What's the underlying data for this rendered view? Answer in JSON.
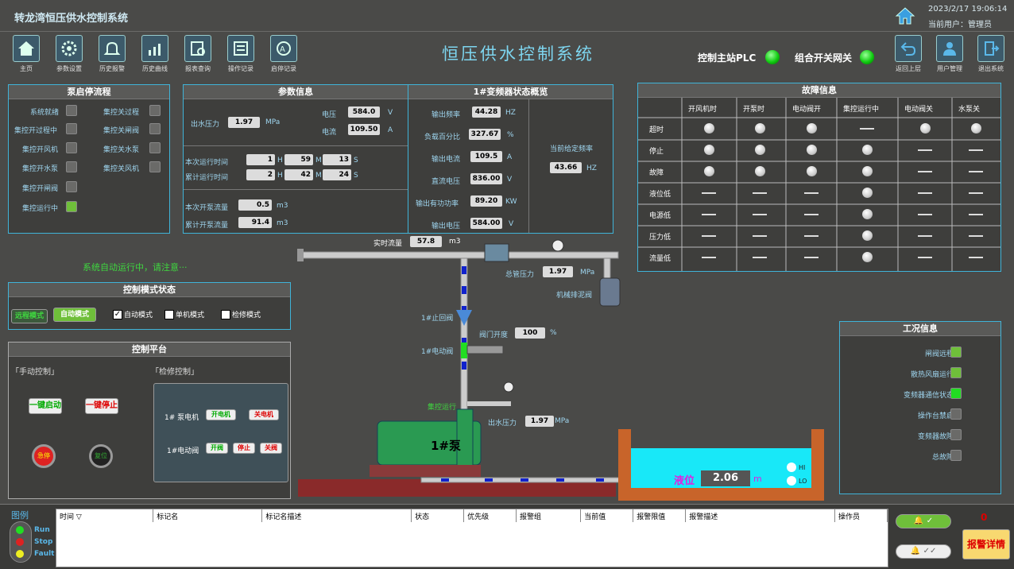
{
  "app": {
    "title": "转龙湾恒压供水控制系统",
    "datetime": "2023/2/17  19:06:14",
    "user": "当前用户：管理员",
    "main_title": "恒压供水控制系统"
  },
  "nav": [
    {
      "label": "主页",
      "icon": "home-icon"
    },
    {
      "label": "参数设置",
      "icon": "gear-icon"
    },
    {
      "label": "历史报警",
      "icon": "bell-icon"
    },
    {
      "label": "历史曲线",
      "icon": "chart-icon"
    },
    {
      "label": "报表查询",
      "icon": "report-icon"
    },
    {
      "label": "操作记录",
      "icon": "log-icon"
    },
    {
      "label": "启停记录",
      "icon": "power-icon"
    }
  ],
  "right_nav": [
    {
      "label": "返回上层",
      "icon": "back-icon"
    },
    {
      "label": "用户管理",
      "icon": "user-icon"
    },
    {
      "label": "退出系统",
      "icon": "exit-icon"
    }
  ],
  "status": {
    "plc": "控制主站PLC",
    "gateway": "组合开关网关"
  },
  "pump_flow": {
    "title": "泵启停流程",
    "left": [
      "系统就绪",
      "集控开过程中",
      "集控开风机",
      "集控开水泵",
      "集控开闸阀",
      "集控运行中"
    ],
    "right": [
      "集控关过程",
      "集控关闸阀",
      "集控关水泵",
      "集控关风机"
    ]
  },
  "params": {
    "title": "参数信息",
    "outlet_pressure_label": "出水压力",
    "outlet_pressure": "1.97",
    "mpa": "MPa",
    "voltage_label": "电压",
    "voltage": "584.0",
    "v": "V",
    "current_label": "电流",
    "current": "109.50",
    "a": "A",
    "run_time_label": "本次运行时间",
    "run_h": "1",
    "run_m": "59",
    "run_s": "13",
    "total_time_label": "累计运行时间",
    "tot_h": "2",
    "tot_m": "42",
    "tot_s": "24",
    "h": "H",
    "m": "M",
    "s": "S",
    "flow_label": "本次开泵流量",
    "flow": "0.5",
    "total_flow_label": "累计开泵流量",
    "total_flow": "91.4",
    "m3": "m3"
  },
  "vfd": {
    "title": "1#变频器状态概览",
    "rows": [
      {
        "label": "输出频率",
        "value": "44.28",
        "unit": "HZ"
      },
      {
        "label": "负载百分比",
        "value": "327.67",
        "unit": "%"
      },
      {
        "label": "输出电流",
        "value": "109.5",
        "unit": "A"
      },
      {
        "label": "直流电压",
        "value": "836.00",
        "unit": "V"
      },
      {
        "label": "输出有功功率",
        "value": "89.20",
        "unit": "KW"
      },
      {
        "label": "输出电压",
        "value": "584.00",
        "unit": "V"
      }
    ],
    "given_label": "当前给定频率",
    "given": "43.66",
    "given_unit": "HZ"
  },
  "fault": {
    "title": "故障信息",
    "cols": [
      "开风机时",
      "开泵时",
      "电动阀开",
      "集控运行中",
      "电动阀关",
      "水泵关"
    ],
    "rows": [
      {
        "label": "超时",
        "cells": [
          1,
          1,
          1,
          0,
          1,
          1
        ]
      },
      {
        "label": "停止",
        "cells": [
          1,
          1,
          1,
          1,
          0,
          0
        ]
      },
      {
        "label": "故障",
        "cells": [
          1,
          1,
          1,
          1,
          0,
          0
        ]
      },
      {
        "label": "液位低",
        "cells": [
          0,
          0,
          0,
          1,
          0,
          0
        ]
      },
      {
        "label": "电源低",
        "cells": [
          0,
          0,
          0,
          1,
          0,
          0
        ]
      },
      {
        "label": "压力低",
        "cells": [
          0,
          0,
          0,
          1,
          0,
          0
        ]
      },
      {
        "label": "流量低",
        "cells": [
          0,
          0,
          0,
          1,
          0,
          0
        ]
      }
    ]
  },
  "auto_msg": "系统自动运行中，请注意···",
  "mode": {
    "title": "控制模式状态",
    "remote": "远程模式",
    "auto": "自动模式",
    "opt_auto": "自动模式",
    "opt_single": "单机模式",
    "opt_repair": "检修模式"
  },
  "platform": {
    "title": "控制平台",
    "manual": "「手动控制」",
    "repair": "「检修控制」",
    "start_all": "一键启动",
    "stop_all": "一键停止",
    "estop": "急停",
    "reset": "复位",
    "motor": "1# 泵电机",
    "motor_on": "开电机",
    "motor_off": "关电机",
    "valve": "1#电动阀",
    "valve_open": "开阀",
    "valve_stop": "停止",
    "valve_close": "关阀"
  },
  "process": {
    "flow_label": "实时流量",
    "flow": "57.8",
    "flow_unit": "m3",
    "total_pressure_label": "总管压力",
    "total_pressure": "1.97",
    "mpa": "MPa",
    "drain_label": "机械排泥阀",
    "check_valve": "1#止回阀",
    "valve_open_label": "阀门开度",
    "valve_open": "100",
    "pct": "%",
    "motor_valve": "1#电动阀",
    "run_label": "集控运行",
    "outlet_label": "出水压力",
    "outlet": "1.97",
    "pump_label": "1#泵",
    "level_label": "液位",
    "level": "2.06",
    "level_unit": "m",
    "hi": "HI",
    "lo": "LO"
  },
  "work": {
    "title": "工况信息",
    "rows": [
      {
        "label": "闸阀远程",
        "state": 1
      },
      {
        "label": "散热风扇运行",
        "state": 1
      },
      {
        "label": "变频器通信状态",
        "state": 2
      },
      {
        "label": "操作台禁启",
        "state": 0
      },
      {
        "label": "变频器故障",
        "state": 0
      },
      {
        "label": "总故障",
        "state": 0
      }
    ]
  },
  "legend": {
    "title": "图例",
    "run": "Run",
    "stop": "Stop",
    "fault": "Fault"
  },
  "alarm": {
    "cols": [
      "时间 ▽",
      "标记名",
      "标记名描述",
      "状态",
      "优先级",
      "报警组",
      "当前值",
      "报警限值",
      "报警描述",
      "操作员"
    ],
    "count": "0",
    "detail": "报警详情"
  }
}
